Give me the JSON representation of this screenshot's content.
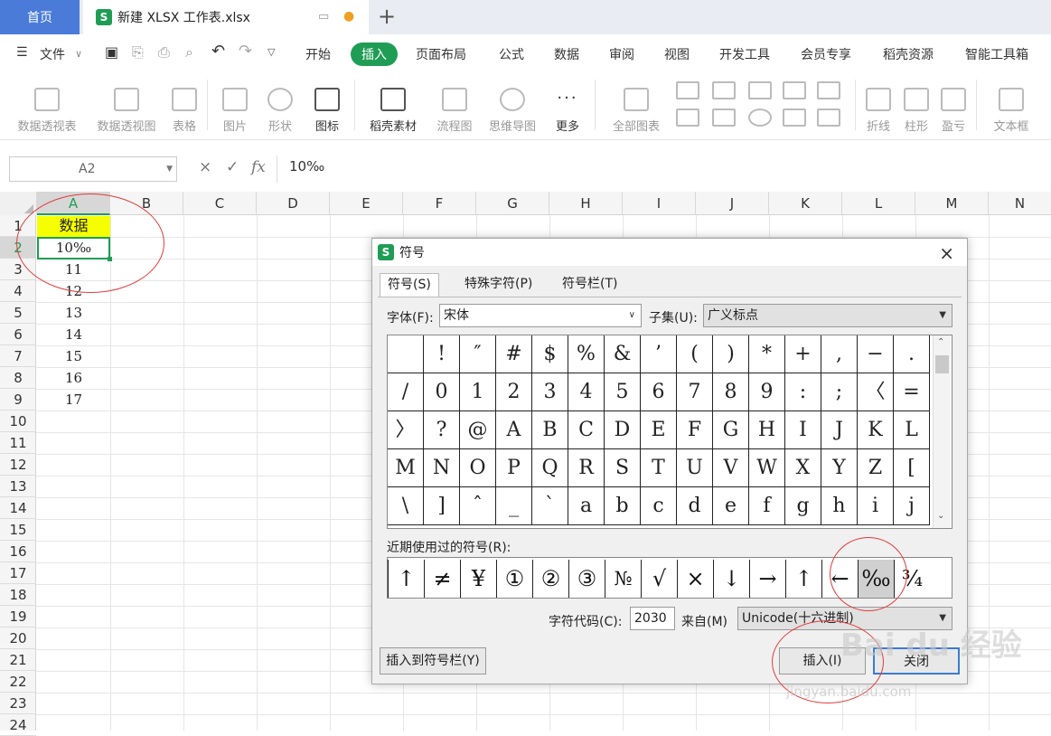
{
  "tabs": {
    "home": "首页",
    "doc": "新建 XLSX 工作表.xlsx",
    "doc_logo": "S",
    "new_tab": "+"
  },
  "menu": {
    "hamburger": "☰",
    "file": "文件",
    "items": [
      "开始",
      "插入",
      "页面布局",
      "公式",
      "数据",
      "审阅",
      "视图",
      "开发工具",
      "会员专享",
      "稻壳资源",
      "智能工具箱"
    ]
  },
  "ribbon": {
    "items": [
      "数据透视表",
      "数据透视图",
      "表格",
      "图片",
      "形状",
      "图标",
      "稻壳素材",
      "流程图",
      "思维导图",
      "更多",
      "全部图表",
      "折线",
      "柱形",
      "盈亏",
      "文本框"
    ]
  },
  "formula": {
    "cell_ref": "A2",
    "cancel": "×",
    "confirm": "✓",
    "fx": "fx",
    "value": "10‰"
  },
  "grid": {
    "columns": [
      "A",
      "B",
      "C",
      "D",
      "E",
      "F",
      "G",
      "H",
      "I",
      "J",
      "K",
      "L",
      "M",
      "N"
    ],
    "rows": [
      "1",
      "2",
      "3",
      "4",
      "5",
      "6",
      "7",
      "8",
      "9",
      "10",
      "11",
      "12",
      "13",
      "14",
      "15",
      "16",
      "17",
      "18",
      "19",
      "20",
      "21",
      "22",
      "23",
      "24"
    ],
    "column_a": [
      "数据",
      "10‰",
      "11",
      "12",
      "13",
      "14",
      "15",
      "16",
      "17"
    ],
    "highlight_color": "#f5ff00",
    "selection_color": "#1f9d55"
  },
  "dialog": {
    "logo": "S",
    "title": "符号",
    "close": "×",
    "tabs": [
      "符号(S)",
      "特殊字符(P)",
      "符号栏(T)"
    ],
    "font_label": "字体(F):",
    "font_value": "宋体",
    "subset_label": "子集(U):",
    "subset_value": "广义标点",
    "symbols": [
      [
        "",
        "!",
        "″",
        "#",
        "$",
        "%",
        "&",
        "’",
        "(",
        ")",
        "*",
        "+",
        ",",
        "−",
        "."
      ],
      [
        "/",
        "0",
        "1",
        "2",
        "3",
        "4",
        "5",
        "6",
        "7",
        "8",
        "9",
        ":",
        ";",
        "〈",
        "="
      ],
      [
        "〉",
        "?",
        "@",
        "A",
        "B",
        "C",
        "D",
        "E",
        "F",
        "G",
        "H",
        "I",
        "J",
        "K",
        "L"
      ],
      [
        "M",
        "N",
        "O",
        "P",
        "Q",
        "R",
        "S",
        "T",
        "U",
        "V",
        "W",
        "X",
        "Y",
        "Z",
        "["
      ],
      [
        "\\",
        "]",
        "ˆ",
        "_",
        "`",
        "a",
        "b",
        "c",
        "d",
        "e",
        "f",
        "g",
        "h",
        "i",
        "j"
      ]
    ],
    "recent_label": "近期使用过的符号(R):",
    "recent": [
      "↑",
      "≠",
      "¥",
      "①",
      "②",
      "③",
      "№",
      "√",
      "×",
      "↓",
      "→",
      "↑",
      "←",
      "‰",
      "¾"
    ],
    "code_label": "字符代码(C):",
    "code_value": "2030",
    "from_label": "来自(M)",
    "from_value": "Unicode(十六进制)",
    "insert_to_bar": "插入到符号栏(Y)",
    "insert": "插入(I)",
    "close_btn": "关闭"
  },
  "watermark": {
    "main": "Bai du 经验",
    "url": "jingyan.baidu.com"
  }
}
